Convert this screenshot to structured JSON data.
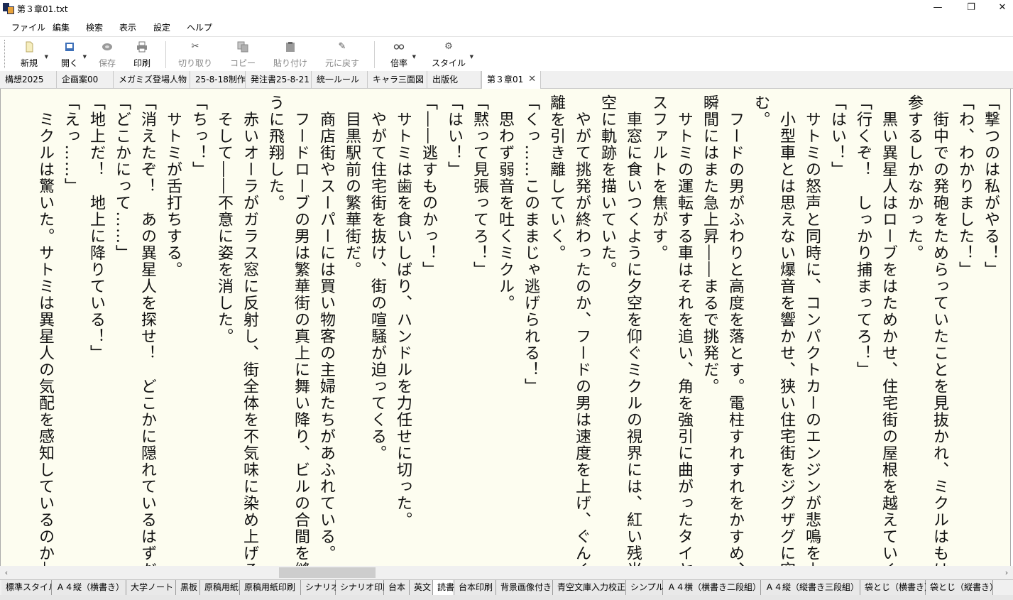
{
  "window": {
    "title": "第３章01.txt",
    "minimize": "—",
    "restore": "❐",
    "close": "✕"
  },
  "menu": [
    "ファイル",
    "編集",
    "検索",
    "表示",
    "設定",
    "ヘルプ"
  ],
  "toolbar": {
    "new": "新規",
    "open": "開く",
    "save": "保存",
    "print": "印刷",
    "cut": "切り取り",
    "copy": "コピー",
    "paste": "貼り付け",
    "undo": "元に戻す",
    "zoom": "倍率",
    "style": "スタイル"
  },
  "doc_tabs": [
    "構想2025",
    "企画案00",
    "メガミズ登場人物",
    "25-8-18制作",
    "発注書25-8-21",
    "統一ルール",
    "キャラ三面図",
    "出版化",
    "第３章01"
  ],
  "active_doc_tab_close": "✕",
  "text_lines": [
    "「撃つのは私がやる！」",
    "「わ、わかりました！」",
    "　街中での発砲をためらっていたことを見抜かれ、ミクルはもはや降",
    "参するしかなかった。",
    "　黒い異星人はローブをはためかせ、住宅街の屋根を越えていく。",
    "「行くぞ！　しっかり捕まってろ！」",
    "「はい！」",
    "　サトミの怒声と同時に、コンパクトカーのエンジンが悲鳴を上げた。",
    "　小型車とは思えない爆音を響かせ、狭い住宅街をジグザグに突き進",
    "む。",
    "　フードの男がふわりと高度を落とす。電柱すれすれをかすめ、次の",
    "瞬間にはまた急上昇――まるで挑発だ。",
    "　サトミの運転する車はそれを追い、角を強引に曲がったタイヤがア",
    "スファルトを焦がす。",
    "　車窓に食いつくように夕空を仰ぐミクルの視界には、紅い残光が夕",
    "空に軌跡を描いていた。",
    "　やがて挑発が終わったのか、フードの男は速度を上げ、ぐんぐん距",
    "離を引き離していく。",
    "「くっ……このままじゃ逃げられる！」",
    "　思わず弱音を吐くミクル。",
    "「黙って見張ってろ！」",
    "「はい！」",
    "「――逃すものかっ！」",
    "　サトミは歯を食いしばり、ハンドルを力任せに切った。",
    "　やがて住宅街を抜け、街の喧騒が迫ってくる。",
    "　目黒駅前の繁華街だ。",
    "　商店街やスーパーには買い物客の主婦たちがあふれている。",
    "　フードローブの男は繁華街の真上に舞い降り、ビルの合間を縫うよ",
    "うに飛翔した。",
    "　赤いオーラがガラス窓に反射し、街全体を不気味に染め上げる。",
    "　そして――不意に姿を消した。",
    "「ちっ！」",
    "　サトミが舌打ちする。",
    "「消えたぞ！　あの異星人を探せ！　どこかに隠れているはずだ！」",
    "「どこかにって……」",
    "「地上だ！　地上に降りている！」",
    "「えっ……」",
    "　ミクルは驚いた。サトミは異星人の気配を感知しているのか――そ"
  ],
  "scroll": {
    "left": "‹",
    "right": "›"
  },
  "style_tabs": [
    "標準スタイル",
    "Ａ４縦（横書き）",
    "大学ノート",
    "黒板",
    "原稿用紙",
    "原稿用紙印刷",
    "シナリオ",
    "シナリオ印刷",
    "台本",
    "英文",
    "読書",
    "台本印刷",
    "背景画像付き",
    "青空文庫入力校正",
    "シンプル",
    "Ａ４横（横書き二段組）",
    "Ａ４縦（縦書き三段組）",
    "袋とじ（横書き）",
    "袋とじ（縦書き）"
  ],
  "active_style_tab": "読書",
  "colors": {
    "editor_bg": "#fdfdf0",
    "tab_bg": "#f0f0f0",
    "text": "#111111"
  }
}
